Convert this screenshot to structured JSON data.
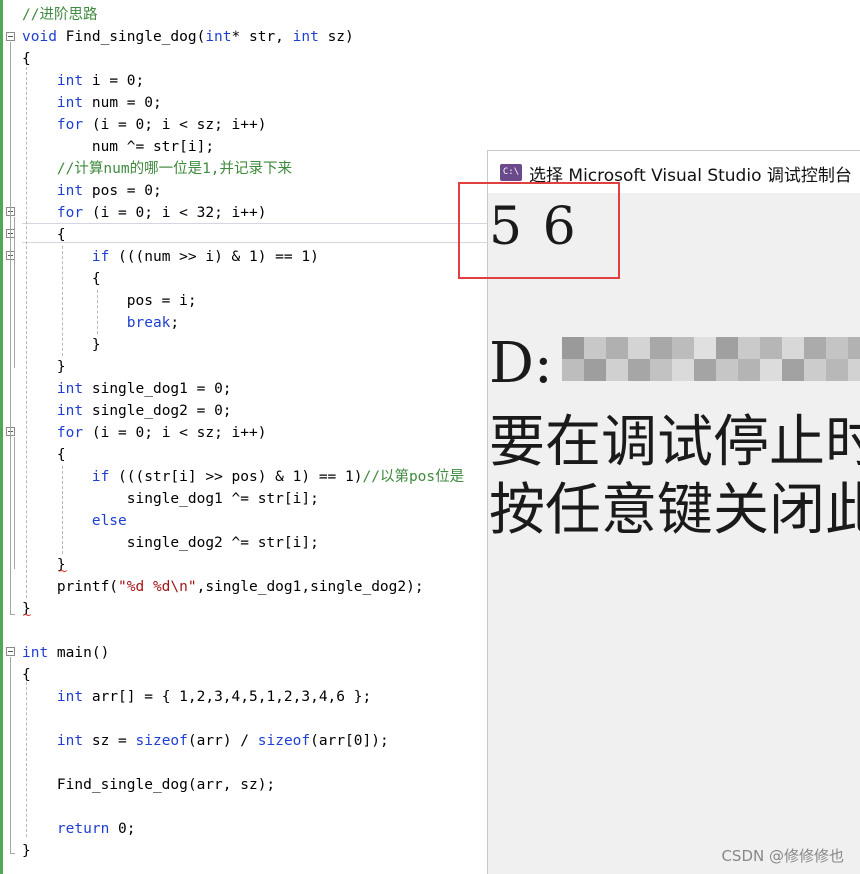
{
  "code_lines": [
    "//进阶思路",
    "void Find_single_dog(int* str, int sz)",
    "{",
    "    int i = 0;",
    "    int num = 0;",
    "    for (i = 0; i < sz; i++)",
    "        num ^= str[i];",
    "    //计算num的哪一位是1,并记录下来",
    "    int pos = 0;",
    "    for (i = 0; i < 32; i++)",
    "    {",
    "        if (((num >> i) & 1) == 1)",
    "        {",
    "            pos = i;",
    "            break;",
    "        }",
    "    }",
    "    int single_dog1 = 0;",
    "    int single_dog2 = 0;",
    "    for (i = 0; i < sz; i++)",
    "    {",
    "        if (((str[i] >> pos) & 1) == 1)//以第pos位是",
    "            single_dog1 ^= str[i];",
    "        else",
    "            single_dog2 ^= str[i];",
    "    }",
    "    printf(\"%d %d\\n\",single_dog1,single_dog2);",
    "}",
    "",
    "int main()",
    "{",
    "",
    "    int arr[] = { 1,2,3,4,5,1,2,3,4,6 };",
    "",
    "    int sz = sizeof(arr) / sizeof(arr[0]);",
    "",
    "    Find_single_dog(arr, sz);",
    "",
    "    return 0;",
    "}"
  ],
  "console": {
    "icon_label": "C:\\",
    "title": "选择 Microsoft Visual Studio 调试控制台",
    "output": "5 6",
    "path_prefix": "D:",
    "line_debug": "要在调试停止时自动关闭控制台",
    "line_close": "按任意键关闭此窗口. . ."
  },
  "watermark": "CSDN @修修修也",
  "colors": {
    "keyword": "#1f3fd1",
    "comment": "#3f8a3f",
    "string": "#a31515",
    "highlight_box": "#e04040",
    "console_icon": "#6a4a8a"
  }
}
